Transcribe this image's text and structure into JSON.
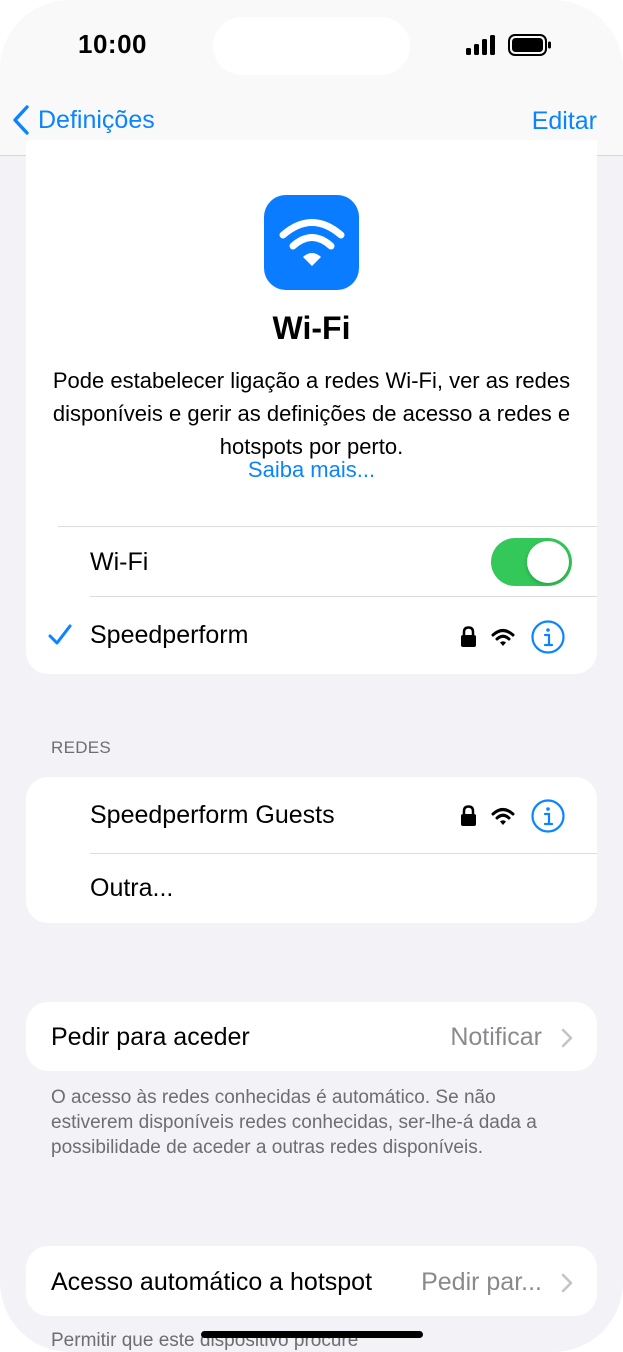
{
  "status": {
    "time": "10:00"
  },
  "nav": {
    "back_label": "Definições",
    "edit_label": "Editar"
  },
  "hero": {
    "title": "Wi-Fi",
    "description": "Pode estabelecer ligação a redes Wi-Fi, ver as redes disponíveis e gerir as definições de acesso a redes e hotspots por perto.",
    "learn_more": "Saiba mais..."
  },
  "wifi": {
    "toggle_label": "Wi-Fi",
    "toggle_on": true,
    "connected_network": "Speedperform"
  },
  "networks": {
    "header": "REDES",
    "items": [
      {
        "name": "Speedperform Guests",
        "secured": true
      },
      {
        "name": "Outra..."
      }
    ]
  },
  "ask_to_join": {
    "label": "Pedir para aceder",
    "value": "Notificar"
  },
  "ask_to_join_note": "O acesso às redes conhecidas é automático. Se não estiverem disponíveis redes conhecidas, ser-lhe-á dada a possibilidade de aceder a outras redes disponíveis.",
  "auto_hotspot": {
    "label": "Acesso automático a hotspot",
    "value": "Pedir par..."
  },
  "auto_hotspot_note": "Permitir que este dispositivo procure",
  "colors": {
    "accent": "#0a84ff",
    "toggle_on": "#34c759",
    "background": "#f2f2f7"
  }
}
